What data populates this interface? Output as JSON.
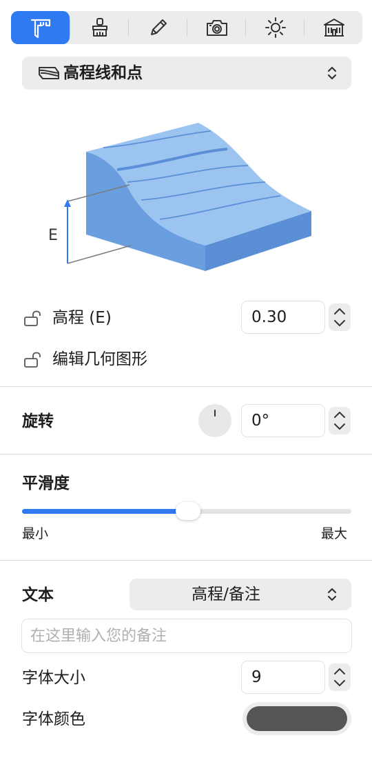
{
  "toolbar": {
    "tabs": [
      {
        "icon": "caliper-icon",
        "active": true
      },
      {
        "icon": "brush-icon",
        "active": false
      },
      {
        "icon": "pencil-icon",
        "active": false
      },
      {
        "icon": "camera-icon",
        "active": false
      },
      {
        "icon": "sun-icon",
        "active": false
      },
      {
        "icon": "building-icon",
        "active": false
      }
    ]
  },
  "type_selector": {
    "label": "高程线和点",
    "icon": "contour-lines-icon"
  },
  "illustration": {
    "axis_label": "E"
  },
  "elevation": {
    "label": "高程 (E)",
    "value": "0.30"
  },
  "edit_geometry": {
    "label": "编辑几何图形"
  },
  "rotation": {
    "title": "旋转",
    "value": "0°"
  },
  "smoothness": {
    "title": "平滑度",
    "min_label": "最小",
    "max_label": "最大",
    "value_fraction": 0.5
  },
  "text": {
    "title": "文本",
    "dropdown_value": "高程/备注",
    "note_placeholder": "在这里输入您的备注",
    "note_value": ""
  },
  "font_size": {
    "label": "字体大小",
    "value": "9"
  },
  "font_color": {
    "label": "字体颜色",
    "color": "#555555"
  },
  "colors": {
    "accent": "#2f7af0",
    "terrain_top": "#9cc4f0",
    "terrain_side": "#6a9fdf",
    "terrain_front": "#5a8fd6",
    "contour": "#5b8fd8"
  }
}
